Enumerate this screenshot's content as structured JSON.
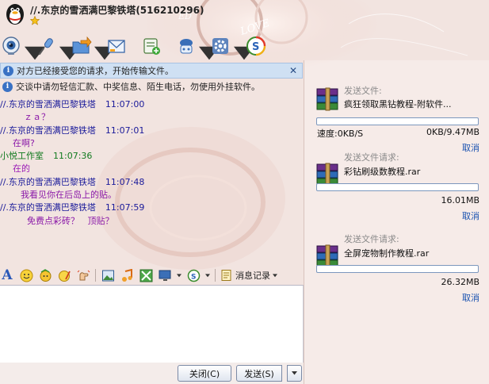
{
  "window": {
    "title": "//.东京的雪洒满巴黎铁塔(516210296)"
  },
  "toolbar": {
    "items": [
      {
        "name": "video-chat"
      },
      {
        "name": "voice-chat"
      },
      {
        "name": "send-file"
      },
      {
        "name": "send-sms"
      },
      {
        "name": "create-group"
      },
      {
        "name": "app-tools"
      },
      {
        "name": "settings"
      },
      {
        "name": "qq-game"
      }
    ]
  },
  "notices": {
    "accepted": "对方已经接受您的请求，开始传输文件。",
    "close_symbol": "✕",
    "warning": "交谈中请勿轻信汇款、中奖信息、陌生电话，勿使用外挂软件。"
  },
  "chat": {
    "messages": [
      {
        "sender": "//.东京的雪洒满巴黎铁塔",
        "time": "11:07:00",
        "text": "ｚａ？",
        "self": false
      },
      {
        "sender": "//.东京的雪洒满巴黎铁塔",
        "time": "11:07:01",
        "text": "在啊?",
        "self": false
      },
      {
        "sender": "小悦工作室",
        "time": "11:07:36",
        "text": "在的",
        "self": true
      },
      {
        "sender": "//.东京的雪洒满巴黎铁塔",
        "time": "11:07:48",
        "text": "我看见你在后岛上的贴。",
        "self": false
      },
      {
        "sender": "//.东京的雪洒满巴黎铁塔",
        "time": "11:07:59",
        "text": "免费点彩砖？   顶贴？",
        "self": false
      }
    ]
  },
  "input_toolbar": {
    "font_label": "A",
    "history_label": "消息记录"
  },
  "buttons": {
    "close": "关闭(C)",
    "send": "发送(S)"
  },
  "transfers": [
    {
      "label": "发送文件:",
      "filename": "疯狂领取黑钻教程-附软件...",
      "progress": 0,
      "speed": "速度:0KB/S",
      "size": "0KB/9.47MB",
      "cancel": "取消"
    },
    {
      "label": "发送文件请求:",
      "filename": "彩钻刷级数教程.rar",
      "progress": 0,
      "speed": "",
      "size": "16.01MB",
      "cancel": "取消"
    },
    {
      "label": "发送文件请求:",
      "filename": "全屏宠物制作教程.rar",
      "progress": 0,
      "speed": "",
      "size": "26.32MB",
      "cancel": "取消"
    }
  ],
  "colors": {
    "link_blue": "#1a52b0",
    "peer_name": "#1a1a9a",
    "self_name": "#117a1e",
    "message_text": "#8a18a8",
    "notice_bg": "#cfe0f3"
  }
}
